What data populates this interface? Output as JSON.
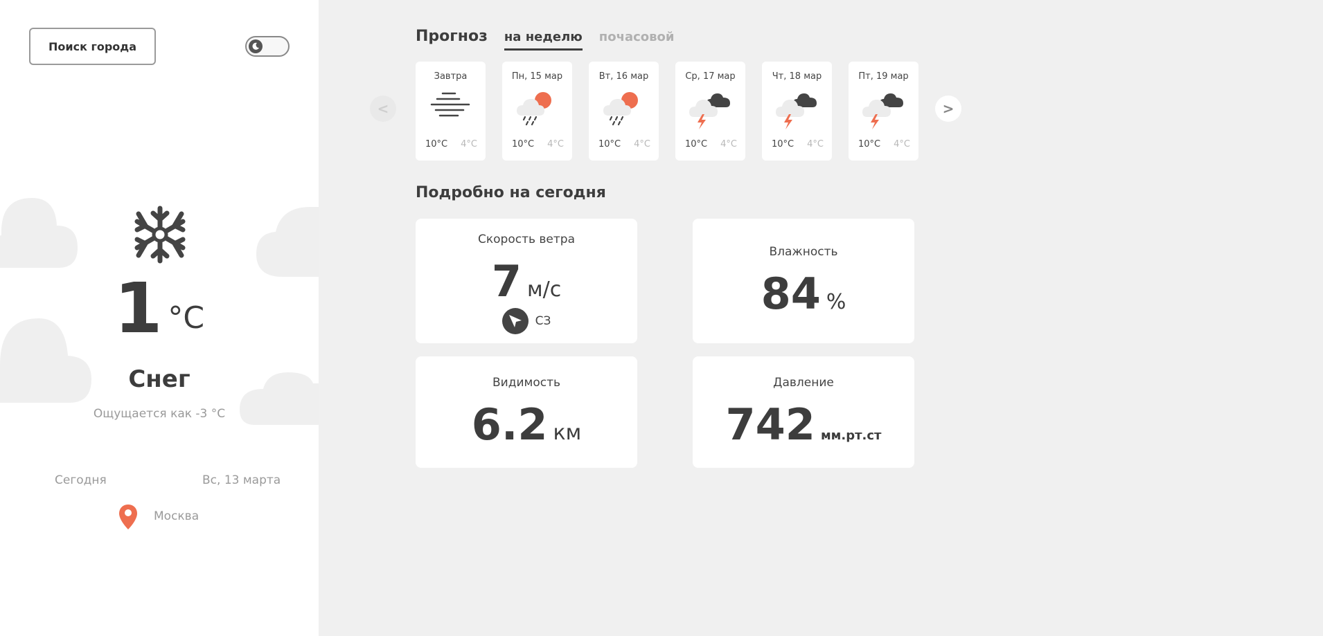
{
  "colors": {
    "accent": "#ee6e4f",
    "text": "#3d3d3d",
    "muted": "#9a9a9a",
    "panel_bg": "#f0f0f0"
  },
  "sidebar": {
    "search_label": "Поиск города",
    "theme_icon": "moon-icon",
    "current": {
      "icon": "snowflake-icon",
      "temp": "1",
      "unit": "°C",
      "condition": "Снег",
      "feels_like": "Ощущается как -3 °C",
      "today_label": "Сегодня",
      "date": "Вс, 13 марта",
      "city": "Москва"
    }
  },
  "forecast": {
    "title": "Прогноз",
    "tabs": [
      {
        "label": "на неделю",
        "active": true
      },
      {
        "label": "почасовой",
        "active": false
      }
    ],
    "prev_label": "<",
    "next_label": ">",
    "days": [
      {
        "label": "Завтра",
        "icon": "fog-icon",
        "max": "10°C",
        "min": "4°C"
      },
      {
        "label": "Пн, 15 мар",
        "icon": "sun-rain-icon",
        "max": "10°C",
        "min": "4°C"
      },
      {
        "label": "Вт, 16 мар",
        "icon": "sun-rain-icon",
        "max": "10°C",
        "min": "4°C"
      },
      {
        "label": "Ср, 17 мар",
        "icon": "thunderstorm-icon",
        "max": "10°C",
        "min": "4°C"
      },
      {
        "label": "Чт, 18 мар",
        "icon": "thunderstorm-icon",
        "max": "10°C",
        "min": "4°C"
      },
      {
        "label": "Пт, 19 мар",
        "icon": "thunderstorm-icon",
        "max": "10°C",
        "min": "4°C"
      }
    ]
  },
  "details": {
    "title": "Подробно на сегодня",
    "wind": {
      "title": "Скорость ветра",
      "value": "7",
      "unit": "м/с",
      "direction": "СЗ"
    },
    "humidity": {
      "title": "Влажность",
      "value": "84",
      "unit": "%"
    },
    "visibility": {
      "title": "Видимость",
      "value": "6.2",
      "unit": "км"
    },
    "pressure": {
      "title": "Давление",
      "value": "742",
      "unit": "мм.рт.ст"
    }
  }
}
